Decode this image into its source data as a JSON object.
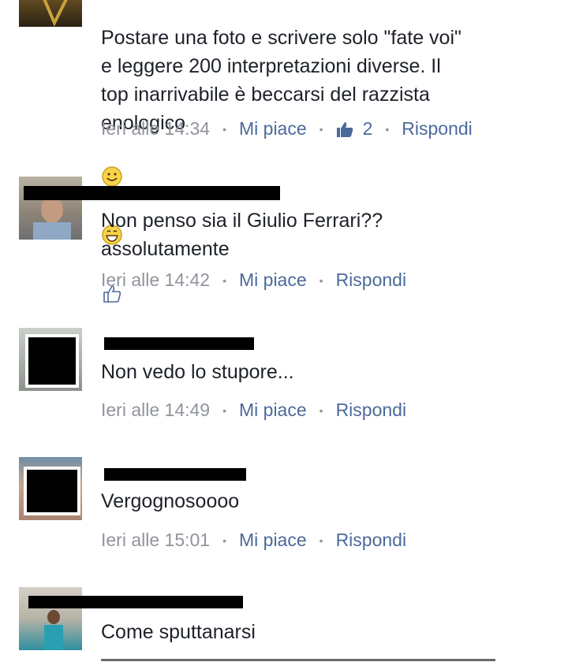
{
  "comments": [
    {
      "text": "Postare una foto e scrivere solo \"fate voi\"\ne leggere 200 interpretazioni diverse. Il\ntop inarrivabile è beccarsi del razzista\nenologico",
      "time": "Ieri alle 14:34",
      "like_label": "Mi piace",
      "like_count": "2",
      "reply_label": "Rispondi"
    },
    {
      "text": "Non penso sia il Giulio Ferrari??\nassolutamente",
      "time": "Ieri alle 14:42",
      "like_label": "Mi piace",
      "reply_label": "Rispondi"
    },
    {
      "text": "Non vedo lo stupore...",
      "time": "Ieri alle 14:49",
      "like_label": "Mi piace",
      "reply_label": "Rispondi"
    },
    {
      "text": "Vergognosoooo",
      "time": "Ieri alle 15:01",
      "like_label": "Mi piace",
      "reply_label": "Rispondi"
    },
    {
      "text": "Come sputtanarsi"
    }
  ],
  "icons": [
    "smile-emoji-icon",
    "grin-emoji-icon",
    "thumbs-up-outline-icon",
    "thumbs-up-filled-icon"
  ],
  "colors": {
    "link": "#4b6a9b",
    "meta": "#90949c",
    "text": "#1d2129",
    "redaction": "#000000"
  }
}
